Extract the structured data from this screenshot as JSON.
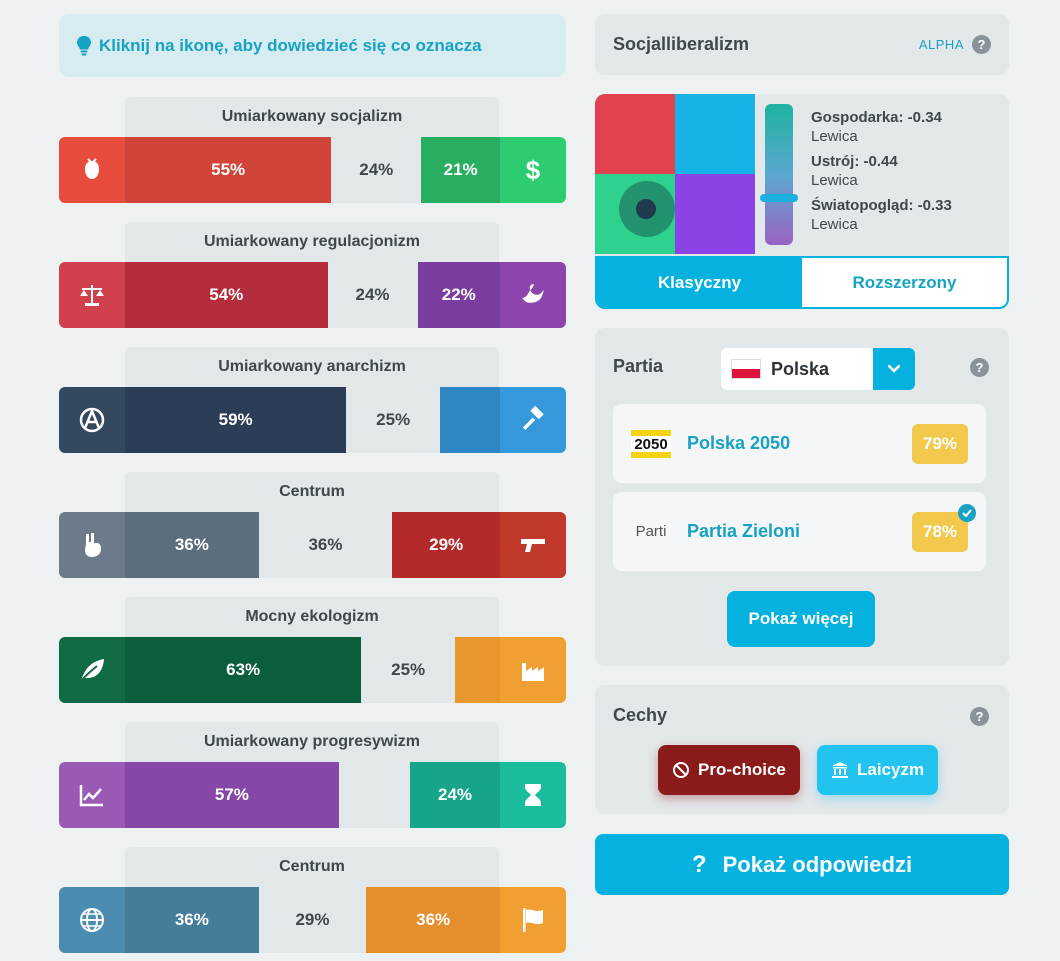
{
  "hint": {
    "text": "Kliknij na ikonę, aby dowiedzieć się co oznacza"
  },
  "axes": [
    {
      "title": "Umiarkowany socjalizm",
      "left_icon": "rose-icon",
      "right_icon": "dollar-icon",
      "left": "55%",
      "mid": "24%",
      "right": "21%",
      "left_pct": 55,
      "mid_pct": 24,
      "right_pct": 21,
      "left_color": "#d0443a",
      "left_icon_bg": "#e74c3c",
      "right_color": "#27ae60",
      "right_icon_bg": "#2ecc71"
    },
    {
      "title": "Umiarkowany regulacjonizm",
      "left_icon": "scales-icon",
      "right_icon": "dove-icon",
      "left": "54%",
      "mid": "24%",
      "right": "22%",
      "left_pct": 54,
      "mid_pct": 24,
      "right_pct": 22,
      "left_color": "#b52d3c",
      "left_icon_bg": "#d0404d",
      "right_color": "#7b3ca0",
      "right_icon_bg": "#8e44ad"
    },
    {
      "title": "Umiarkowany anarchizm",
      "left_icon": "anarchy-icon",
      "right_icon": "gavel-icon",
      "left": "59%",
      "mid": "25%",
      "right": "",
      "left_pct": 59,
      "mid_pct": 25,
      "right_pct": 16,
      "left_color": "#2c3e57",
      "left_icon_bg": "#34495e",
      "right_color": "#2f86c4",
      "right_icon_bg": "#3498db"
    },
    {
      "title": "Centrum",
      "left_icon": "peace-hand-icon",
      "right_icon": "gun-icon",
      "left": "36%",
      "mid": "36%",
      "right": "29%",
      "left_pct": 36,
      "mid_pct": 36,
      "right_pct": 29,
      "left_color": "#5d6d7e",
      "left_icon_bg": "#6c7a89",
      "right_color": "#b42a2a",
      "right_icon_bg": "#c0392b"
    },
    {
      "title": "Mocny ekologizm",
      "left_icon": "leaf-icon",
      "right_icon": "factory-icon",
      "left": "63%",
      "mid": "25%",
      "right": "",
      "left_pct": 63,
      "mid_pct": 25,
      "right_pct": 12,
      "left_color": "#0b5e3c",
      "left_icon_bg": "#106b45",
      "right_color": "#e8962e",
      "right_icon_bg": "#f0a033"
    },
    {
      "title": "Umiarkowany progresywizm",
      "left_icon": "chart-up-icon",
      "right_icon": "hourglass-icon",
      "left": "57%",
      "mid": "",
      "right": "24%",
      "left_pct": 57,
      "mid_pct": 19,
      "right_pct": 24,
      "left_color": "#8648a8",
      "left_icon_bg": "#9b59b6",
      "right_color": "#17a589",
      "right_icon_bg": "#1abc9c"
    },
    {
      "title": "Centrum",
      "left_icon": "globe-icon",
      "right_icon": "flag-icon",
      "left": "36%",
      "mid": "29%",
      "right": "36%",
      "left_pct": 36,
      "mid_pct": 29,
      "right_pct": 36,
      "left_color": "#447c9a",
      "left_icon_bg": "#4a8bb0",
      "right_color": "#e58e2e",
      "right_icon_bg": "#f0a033"
    }
  ],
  "ideology": {
    "name": "Socjalliberalizm",
    "badge": "ALPHA",
    "help": "?"
  },
  "compass": {
    "stats": [
      {
        "label": "Gospodarka: -0.34",
        "value": "Lewica"
      },
      {
        "label": "Ustrój: -0.44",
        "value": "Lewica"
      },
      {
        "label": "Światopogląd: -0.33",
        "value": "Lewica"
      }
    ],
    "tabs": {
      "classic": "Klasyczny",
      "extended": "Rozszerzony"
    }
  },
  "parties": {
    "label": "Partia",
    "country": "Polska",
    "help": "?",
    "items": [
      {
        "name": "Polska 2050",
        "pct": "79%",
        "logo_text": "2050"
      },
      {
        "name": "Partia Zieloni",
        "pct": "78%",
        "logo_alt": "Parti"
      }
    ],
    "more": "Pokaż więcej"
  },
  "traits": {
    "label": "Cechy",
    "help": "?",
    "items": [
      "Pro-choice",
      "Laicyzm"
    ]
  },
  "answers_button": {
    "q": "?",
    "label": "Pokaż odpowiedzi"
  }
}
